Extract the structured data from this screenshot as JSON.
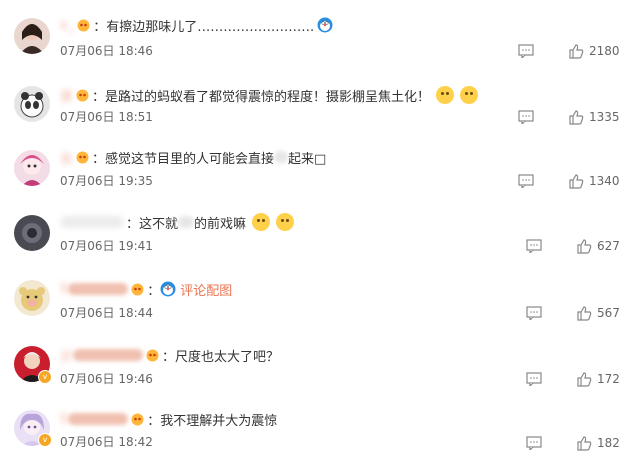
{
  "comments": [
    {
      "user": "x_",
      "text": "有擦边那味儿了………………………",
      "time": "07月06日 18:46",
      "likes": "2180",
      "emoji": "doraemon-icon"
    },
    {
      "user": "茶",
      "text": "是路过的蚂蚁看了都觉得震惊的程度！摄影棚呈焦土化！",
      "time": "07月06日 18:51",
      "likes": "1335"
    },
    {
      "user": "女",
      "text": "感觉这节目里的人可能会直接",
      "text2": "起来□",
      "time": "07月06日 19:35",
      "likes": "1340"
    },
    {
      "user": "",
      "text": "这不就",
      "text2": "的前戏嘛",
      "time": "07月06日 19:41",
      "likes": "627"
    },
    {
      "user": "S",
      "text": "评论配图",
      "time": "07月06日 18:44",
      "likes": "567"
    },
    {
      "user": "沂",
      "text": "尺度也太大了吧？",
      "time": "07月06日 19:46",
      "likes": "172"
    },
    {
      "user": "S",
      "text": "我不理解并大为震惊",
      "time": "07月06日 18:42",
      "likes": "182"
    }
  ]
}
